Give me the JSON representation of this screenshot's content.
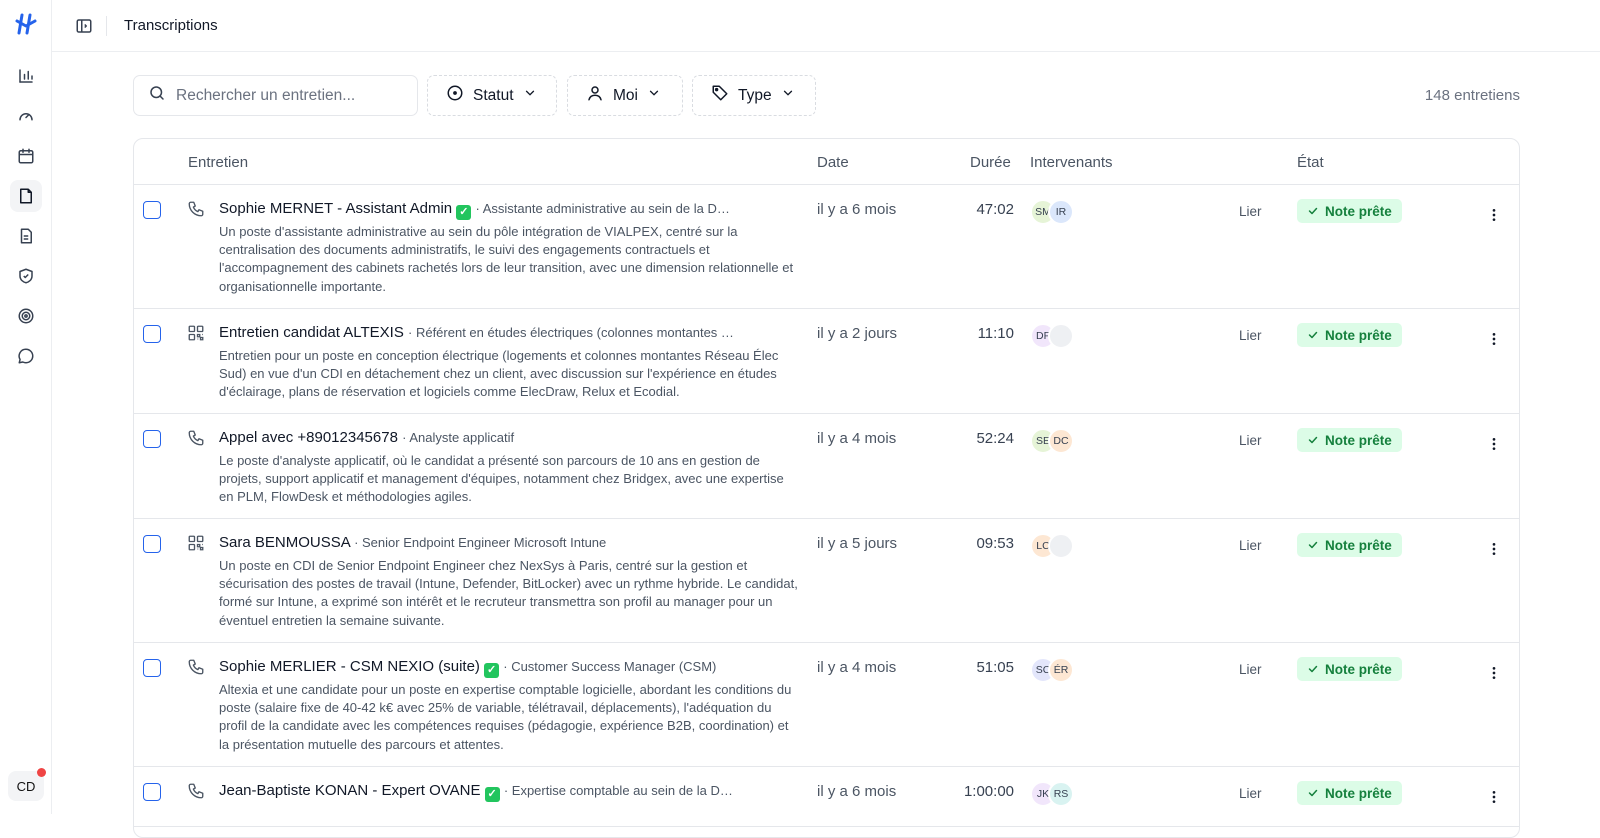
{
  "sidebar": {
    "nav_icons": [
      "chart-icon",
      "gauge-icon",
      "calendar-icon",
      "transcriptions-icon",
      "document-icon",
      "shield-check-icon",
      "target-icon",
      "chat-icon"
    ],
    "user_initials": "CD"
  },
  "header": {
    "title": "Transcriptions"
  },
  "toolbar": {
    "search_placeholder": "Rechercher un entretien...",
    "filter_status": "Statut",
    "filter_user": "Moi",
    "filter_type": "Type",
    "count": "148 entretiens"
  },
  "table": {
    "columns": {
      "entretien": "Entretien",
      "date": "Date",
      "duree": "Durée",
      "intervenants": "Intervenants",
      "etat": "État"
    },
    "rows": [
      {
        "icon": "phone-icon",
        "title": "Sophie MERNET - Assistant Admin",
        "verified": true,
        "subtitle": "· Assistante administrative au sein de la D…",
        "desc": "Un poste d'assistante administrative au sein du pôle intégration de VIALPEX, centré sur la centralisation des documents administratifs, le suivi des engagements contractuels et l'accompagnement des cabinets rachetés lors de leur transition, avec une dimension relationnelle et organisationnelle importante.",
        "date": "il y a 6 mois",
        "duration": "47:02",
        "avatars": [
          {
            "initials": "SM",
            "color": "#e6f4d7"
          },
          {
            "initials": "IR",
            "color": "#dbe7fb"
          }
        ],
        "link": "Lier",
        "status": "Note prête"
      },
      {
        "icon": "qr-icon",
        "title": "Entretien candidat ALTEXIS",
        "verified": false,
        "subtitle": "· Référent en études électriques (colonnes montantes …",
        "desc": "Entretien pour un poste en conception électrique (logements et colonnes montantes Réseau Élec Sud) en vue d'un CDI en détachement chez un client, avec discussion sur l'expérience en études d'éclairage, plans de réservation et logiciels comme ElecDraw, Relux et Ecodial.",
        "date": "il y a 2 jours",
        "duration": "11:10",
        "avatars": [
          {
            "initials": "DF",
            "color": "#f1e6fb"
          },
          {
            "initials": "",
            "color": "#eef0f3"
          }
        ],
        "link": "Lier",
        "status": "Note prête"
      },
      {
        "icon": "phone-icon",
        "title": "Appel avec +89012345678",
        "verified": false,
        "subtitle": "· Analyste applicatif",
        "desc": "Le poste d'analyste applicatif, où le candidat a présenté son parcours de 10 ans en gestion de projets, support applicatif et management d'équipes, notamment chez Bridgex, avec une expertise en PLM, FlowDesk et méthodologies agiles.",
        "date": "il y a 4 mois",
        "duration": "52:24",
        "avatars": [
          {
            "initials": "SE",
            "color": "#e6f4d7"
          },
          {
            "initials": "DC",
            "color": "#fde7d3"
          }
        ],
        "link": "Lier",
        "status": "Note prête"
      },
      {
        "icon": "qr-icon",
        "title": "Sara BENMOUSSA",
        "verified": false,
        "subtitle": "· Senior Endpoint Engineer Microsoft Intune",
        "desc": "Un poste en CDI de Senior Endpoint Engineer chez NexSys à Paris, centré sur la gestion et sécurisation des postes de travail (Intune, Defender, BitLocker) avec un rythme hybride. Le candidat, formé sur Intune, a exprimé son intérêt et le recruteur transmettra son profil au manager pour un éventuel entretien la semaine suivante.",
        "date": "il y a 5 jours",
        "duration": "09:53",
        "avatars": [
          {
            "initials": "LC",
            "color": "#fde7d3"
          },
          {
            "initials": "",
            "color": "#eef0f3"
          }
        ],
        "link": "Lier",
        "status": "Note prête"
      },
      {
        "icon": "phone-icon",
        "title": "Sophie MERLIER - CSM NEXIO (suite)",
        "verified": true,
        "subtitle": "· Customer Success Manager (CSM)",
        "desc": "Altexia et une candidate pour un poste en expertise comptable logicielle, abordant les conditions du poste (salaire fixe de 40-42 k€ avec 25% de variable, télétravail, déplacements), l'adéquation du profil de la candidate avec les compétences requises (pédagogie, expérience B2B, coordination) et la présentation mutuelle des parcours et attentes.",
        "date": "il y a 4 mois",
        "duration": "51:05",
        "avatars": [
          {
            "initials": "SC",
            "color": "#e3e6fb"
          },
          {
            "initials": "ÉR",
            "color": "#fde7d3"
          }
        ],
        "link": "Lier",
        "status": "Note prête"
      },
      {
        "icon": "phone-icon",
        "title": "Jean-Baptiste KONAN - Expert OVANE",
        "verified": true,
        "subtitle": "· Expertise comptable au sein de la D…",
        "desc": "",
        "date": "il y a 6 mois",
        "duration": "1:00:00",
        "avatars": [
          {
            "initials": "JK",
            "color": "#f1e6fb"
          },
          {
            "initials": "RS",
            "color": "#d9f3f1"
          }
        ],
        "link": "Lier",
        "status": "Note prête"
      }
    ]
  }
}
